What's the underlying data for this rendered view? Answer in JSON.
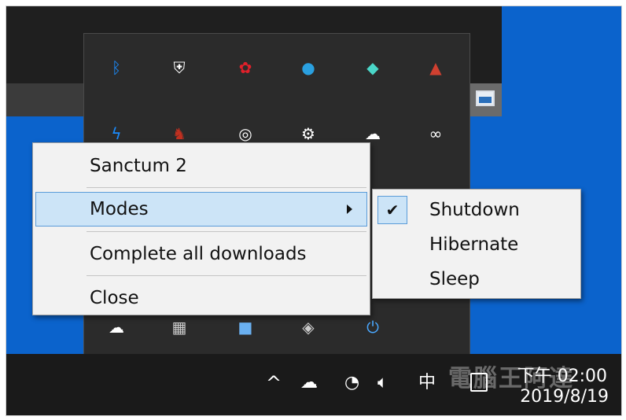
{
  "context_menu": {
    "items": [
      {
        "label": "Sanctum 2"
      },
      {
        "label": "Modes"
      },
      {
        "label": "Complete all downloads"
      },
      {
        "label": "Close"
      }
    ]
  },
  "modes_submenu": {
    "items": [
      {
        "label": "Shutdown",
        "checked": true
      },
      {
        "label": "Hibernate",
        "checked": false
      },
      {
        "label": "Sleep",
        "checked": false
      }
    ]
  },
  "tray_icons": [
    {
      "name": "bluetooth-icon",
      "glyph": "ᛒ",
      "color": "#1a8cff"
    },
    {
      "name": "windows-security-icon",
      "glyph": "⛨",
      "color": "#ffffff"
    },
    {
      "name": "cherry-icon",
      "glyph": "✿",
      "color": "#e0202a"
    },
    {
      "name": "globe-icon",
      "glyph": "●",
      "color": "#2aa0e0"
    },
    {
      "name": "nordvpn-icon",
      "glyph": "◆",
      "color": "#4ad6c8"
    },
    {
      "name": "user-app-icon",
      "glyph": "▲",
      "color": "#d04030"
    },
    {
      "name": "lightning-icon",
      "glyph": "ϟ",
      "color": "#1a8cff"
    },
    {
      "name": "msi-dragon-icon",
      "glyph": "♞",
      "color": "#c03020"
    },
    {
      "name": "onepassword-icon",
      "glyph": "◎",
      "color": "#ffffff"
    },
    {
      "name": "steam-icon",
      "glyph": "⚙",
      "color": "#ffffff"
    },
    {
      "name": "cloud-sync-icon",
      "glyph": "☁",
      "color": "#ffffff"
    },
    {
      "name": "creative-cloud-icon",
      "glyph": "∞",
      "color": "#ffffff"
    },
    {
      "name": "cloud-upload-icon",
      "glyph": "☁",
      "color": "#ffffff"
    },
    {
      "name": "gpu-z-icon",
      "glyph": "▦",
      "color": "#cccccc"
    },
    {
      "name": "blue-folder-icon",
      "glyph": "■",
      "color": "#6ab0f0"
    },
    {
      "name": "cube-icon",
      "glyph": "◈",
      "color": "#cccccc"
    },
    {
      "name": "power-icon",
      "glyph": "⏻",
      "color": "#4aa8ff"
    }
  ],
  "taskbar": {
    "chevron": "^",
    "ime": "中",
    "time": "下午 02:00",
    "date": "2019/8/19"
  },
  "watermark": "電腦王阿達"
}
